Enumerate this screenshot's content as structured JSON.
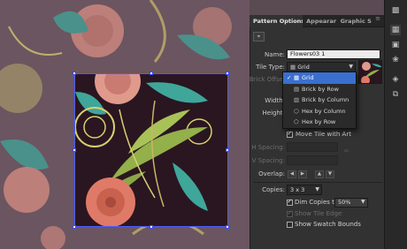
{
  "panel": {
    "tabs": [
      {
        "label": "Pattern Options"
      },
      {
        "label": "Appearar"
      },
      {
        "label": "Graphic S"
      }
    ],
    "tab_menu_icon": "panel-menu-icon",
    "name_label": "Name:",
    "name_value": "Flowers03 1",
    "tile_type_label": "Tile Type:",
    "tile_type_value": "Grid",
    "brick_offset_label": "Brick Offset:",
    "width_label": "Width:",
    "height_label": "Height:",
    "move_tile_label": "Move Tile with Art",
    "h_spacing_label": "H Spacing:",
    "v_spacing_label": "V Spacing:",
    "overlap_label": "Overlap:",
    "copies_label": "Copies:",
    "copies_value": "3 x 3",
    "dim_copies_label": "Dim Copies to:",
    "dim_copies_value": "50%",
    "show_tile_edge_label": "Show Tile Edge",
    "show_swatch_bounds_label": "Show Swatch Bounds",
    "tile_type_options": [
      {
        "label": "Grid",
        "selected": true
      },
      {
        "label": "Brick by Row",
        "selected": false
      },
      {
        "label": "Brick by Column",
        "selected": false
      },
      {
        "label": "Hex by Column",
        "selected": false
      },
      {
        "label": "Hex by Row",
        "selected": false
      }
    ]
  },
  "icons": {
    "tile_edit": "tile-edit-icon",
    "overlap": [
      "overlap-left-icon",
      "overlap-right-icon",
      "overlap-top-icon",
      "overlap-bottom-icon"
    ],
    "rightbar": [
      "libraries-icon",
      "swatches-icon",
      "color-guide-icon",
      "symbols-icon",
      "layers-icon",
      "artboards-icon"
    ]
  },
  "colors": {
    "panel_bg": "#323232",
    "selection": "#3a6fd0",
    "tile_bg": "#2a1620",
    "canvas_bg": "#6b5560",
    "bounding_box": "#4a5cff"
  },
  "state": {
    "move_tile_with_art": true,
    "dim_copies": true,
    "show_tile_edge": true,
    "show_swatch_bounds": false
  }
}
